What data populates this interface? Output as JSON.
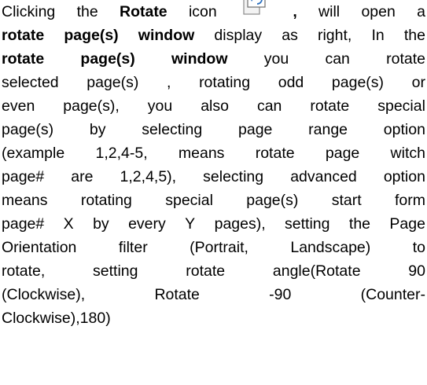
{
  "lines": [
    [
      "Clicking",
      "the",
      "@Rotate",
      "icon",
      "[icon]",
      "@,",
      "will",
      "open",
      "a"
    ],
    [
      "@rotate",
      "@page(s)",
      "@window",
      "display",
      "as",
      "right,",
      "In",
      "the"
    ],
    [
      "@rotate",
      "@page(s)",
      "@window",
      "you",
      "can",
      "rotate"
    ],
    [
      "selected",
      "page(s)",
      ",",
      "rotating",
      "odd",
      "page(s)",
      "or"
    ],
    [
      "even",
      "page(s),",
      "you",
      "also",
      "can",
      "rotate",
      "special"
    ],
    [
      "page(s)",
      "by",
      "selecting",
      "page",
      "range",
      "option"
    ],
    [
      "(example",
      "1,2,4-5,",
      "means",
      "rotate",
      "page",
      "witch"
    ],
    [
      "page#",
      "are",
      "1,2,4,5),",
      "selecting",
      "advanced",
      "option"
    ],
    [
      "means",
      "rotating",
      "special",
      "page(s)",
      "start",
      "form"
    ],
    [
      "page#",
      "X",
      "by",
      "every",
      "Y",
      "pages),",
      "setting",
      "the",
      "Page"
    ],
    [
      "Orientation",
      "filter",
      "(Portrait,",
      "Landscape)",
      "to"
    ],
    [
      "rotate,",
      "setting",
      "rotate",
      "angle(Rotate",
      "90"
    ],
    [
      "(Clockwise),",
      "Rotate",
      "-90",
      "(Counter-"
    ],
    [
      "Clockwise),180)"
    ]
  ],
  "icon_name": "rotate-page-icon"
}
